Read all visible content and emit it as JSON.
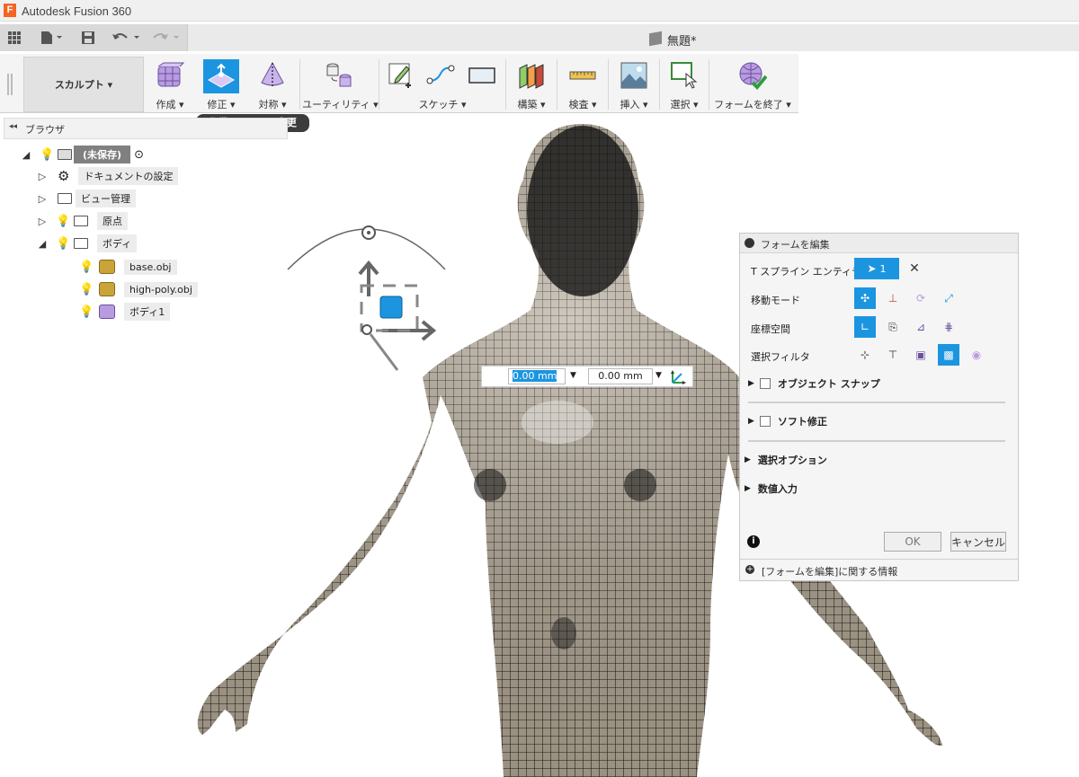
{
  "app": {
    "title": "Autodesk Fusion 360",
    "logo_letter": "F"
  },
  "document": {
    "name": "無題*"
  },
  "workspace": {
    "label": "スカルプト ▾"
  },
  "toolbar": [
    {
      "label": "作成 ▾",
      "icon": "create-icon"
    },
    {
      "label": "修正 ▾",
      "icon": "modify-icon",
      "active": true
    },
    {
      "label": "対称 ▾",
      "icon": "symmetry-icon"
    },
    {
      "label": "ユーティリティ ▾",
      "icon": "utility-icon"
    },
    {
      "label": "スケッチ ▾",
      "icon": "sketch-icon"
    },
    {
      "label": "構築 ▾",
      "icon": "construct-icon"
    },
    {
      "label": "検査 ▾",
      "icon": "inspect-icon"
    },
    {
      "label": "挿入 ▾",
      "icon": "insert-icon"
    },
    {
      "label": "選択 ▾",
      "icon": "select-icon"
    },
    {
      "label": "フォームを終了 ▾",
      "icon": "finish-form-icon"
    }
  ],
  "tooltip": "作業スペースを変更",
  "browser": {
    "title": "ブラウザ",
    "root": "(未保存)",
    "items": [
      {
        "label": "ドキュメントの設定"
      },
      {
        "label": "ビュー管理"
      },
      {
        "label": "原点"
      },
      {
        "label": "ボディ"
      }
    ],
    "bodies": [
      {
        "label": "base.obj"
      },
      {
        "label": "high-poly.obj"
      },
      {
        "label": "ボディ1"
      }
    ]
  },
  "value_input": {
    "x": "0.00 mm",
    "y": "0.00 mm"
  },
  "form_panel": {
    "title": "フォームを編集",
    "rows": [
      {
        "label": "T スプライン エンティティ"
      },
      {
        "label": "移動モード"
      },
      {
        "label": "座標空間"
      },
      {
        "label": "選択フィルタ"
      }
    ],
    "entity_count": "1",
    "sections": [
      {
        "label": "オブジェクト スナップ"
      },
      {
        "label": "ソフト修正"
      },
      {
        "label": "選択オプション"
      },
      {
        "label": "数値入力"
      }
    ],
    "ok": "OK",
    "cancel": "キャンセル",
    "footer": "[フォームを編集]に関する情報"
  },
  "colors": {
    "accent": "#1c95e0",
    "mesh": "#b5aa98",
    "logo": "#f26522"
  }
}
